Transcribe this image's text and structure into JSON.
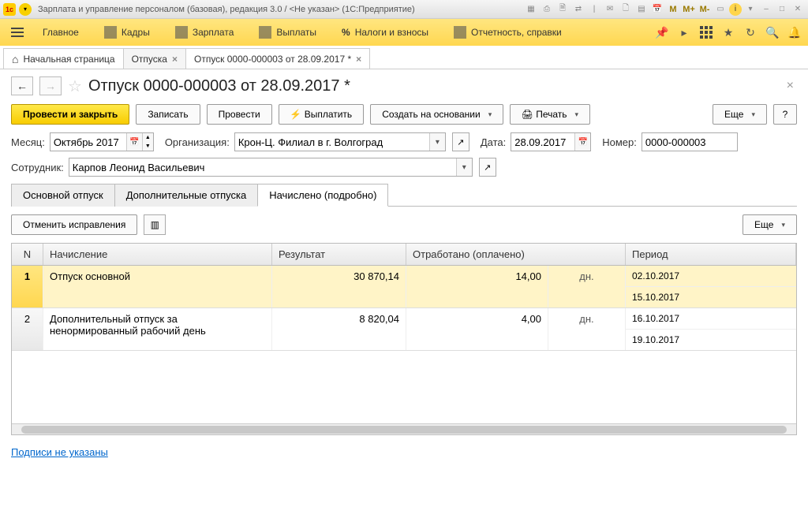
{
  "window": {
    "title": "Зарплата и управление персоналом (базовая), редакция 3.0 / <Не указан>  (1С:Предприятие)",
    "memory_labels": [
      "M",
      "M+",
      "M-"
    ]
  },
  "mainmenu": {
    "items": [
      {
        "label": "Главное"
      },
      {
        "label": "Кадры"
      },
      {
        "label": "Зарплата"
      },
      {
        "label": "Выплаты"
      },
      {
        "label": "Налоги и взносы"
      },
      {
        "label": "Отчетность, справки"
      }
    ]
  },
  "tabs": {
    "home": "Начальная страница",
    "list": [
      {
        "label": "Отпуска"
      },
      {
        "label": "Отпуск 0000-000003 от 28.09.2017 *"
      }
    ]
  },
  "page": {
    "title": "Отпуск 0000-000003 от 28.09.2017 *"
  },
  "toolbar": {
    "post_close": "Провести и закрыть",
    "save": "Записать",
    "post": "Провести",
    "pay": "Выплатить",
    "create_based": "Создать на основании",
    "print": "Печать",
    "more": "Еще",
    "help": "?"
  },
  "form": {
    "month_label": "Месяц:",
    "month_value": "Октябрь 2017",
    "org_label": "Организация:",
    "org_value": "Крон-Ц. Филиал в г. Волгоград",
    "date_label": "Дата:",
    "date_value": "28.09.2017",
    "number_label": "Номер:",
    "number_value": "0000-000003",
    "employee_label": "Сотрудник:",
    "employee_value": "Карпов Леонид Васильевич"
  },
  "inner_tabs": {
    "main": "Основной отпуск",
    "additional": "Дополнительные отпуска",
    "detailed": "Начислено (подробно)"
  },
  "subtoolbar": {
    "cancel_fix": "Отменить исправления",
    "more": "Еще"
  },
  "grid": {
    "headers": {
      "n": "N",
      "calc": "Начисление",
      "res": "Результат",
      "work": "Отработано (оплачено)",
      "period": "Период"
    },
    "rows": [
      {
        "n": "1",
        "calc": "Отпуск основной",
        "res": "30 870,14",
        "work": "14,00",
        "unit": "дн.",
        "period_from": "02.10.2017",
        "period_to": "15.10.2017"
      },
      {
        "n": "2",
        "calc": "Дополнительный отпуск за ненормированный рабочий день",
        "res": "8 820,04",
        "work": "4,00",
        "unit": "дн.",
        "period_from": "16.10.2017",
        "period_to": "19.10.2017"
      }
    ]
  },
  "signatures": "Подписи не указаны"
}
